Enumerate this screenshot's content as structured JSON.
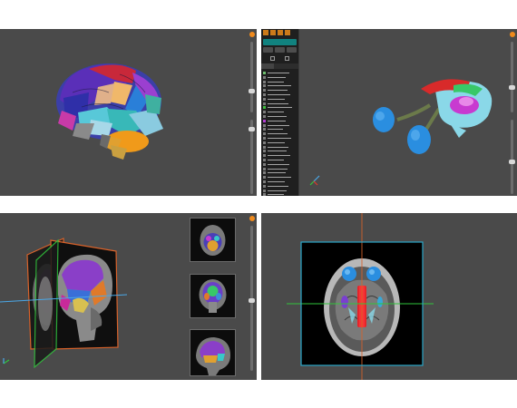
{
  "panels": {
    "top_left": {
      "view": "3d-brain-segmentation"
    },
    "top_right": {
      "view": "3d-structures-with-structure-list",
      "structure_list": {
        "header_color": "#11827f",
        "tool_icons": [
          "select-icon",
          "paint-icon",
          "move-icon",
          "settings-icon"
        ],
        "items": [
          {
            "color": "#6fbf6f"
          },
          {
            "color": "#7d7d7d"
          },
          {
            "color": "#7d7d7d"
          },
          {
            "color": "#7d7d7d"
          },
          {
            "color": "#7d7d7d"
          },
          {
            "color": "#7d7d7d"
          },
          {
            "color": "#7d7d7d"
          },
          {
            "color": "#7d7d7d"
          },
          {
            "color": "#3fbf3f"
          },
          {
            "color": "#7d7d7d"
          },
          {
            "color": "#7d7d7d"
          },
          {
            "color": "#b23fd1"
          },
          {
            "color": "#7d7d7d"
          },
          {
            "color": "#7d7d7d"
          },
          {
            "color": "#7d7d7d"
          },
          {
            "color": "#7d7d7d"
          },
          {
            "color": "#7d7d7d"
          },
          {
            "color": "#7d7d7d"
          },
          {
            "color": "#7d7d7d"
          },
          {
            "color": "#7d7d7d"
          },
          {
            "color": "#7d7d7d"
          },
          {
            "color": "#7d7d7d"
          },
          {
            "color": "#7d7d7d"
          },
          {
            "color": "#7d7d7d"
          },
          {
            "color": "#7d7d7d"
          },
          {
            "color": "#7d7d7d"
          },
          {
            "color": "#7d7d7d"
          },
          {
            "color": "#7d7d7d"
          },
          {
            "color": "#7d7d7d"
          },
          {
            "color": "#7d7d7d"
          },
          {
            "color": "#7d7d7d"
          },
          {
            "color": "#7d7d7d"
          }
        ]
      }
    },
    "bottom_left": {
      "view": "3d-mri-slice-planes",
      "thumbnails": [
        "axial-thumbnail",
        "coronal-thumbnail",
        "sagittal-thumbnail"
      ]
    },
    "bottom_right": {
      "view": "axial-mri-slice"
    }
  },
  "colors": {
    "viewport_bg": "#4a4a4a",
    "accent": "#f08a1c",
    "slice_border_orange": "#d9622a",
    "slice_border_cyan": "#2aa6c8",
    "axis_green": "#31c43c",
    "axis_blue": "#4aa8e8",
    "axis_red": "#e03a2a"
  }
}
